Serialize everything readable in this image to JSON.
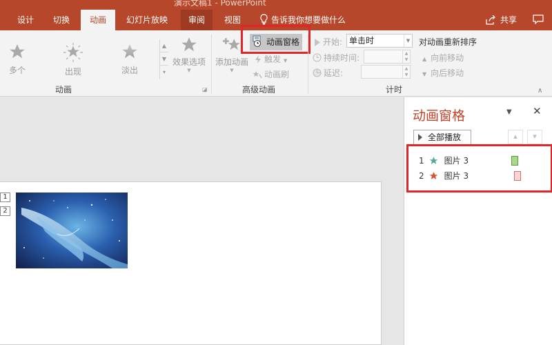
{
  "window": {
    "title": "演示文稿1 - PowerPoint"
  },
  "tabs": [
    "设计",
    "切换",
    "动画",
    "幻灯片放映",
    "审阅",
    "视图"
  ],
  "tell_me": "告诉我你想要做什么",
  "share_label": "共享",
  "ribbon": {
    "gallery": [
      "多个",
      "出现",
      "淡出"
    ],
    "effect_options": "效果选项",
    "add_animation": "添加动画",
    "animation_pane": "动画窗格",
    "trigger": "触发",
    "animation_painter": "动画刷",
    "start_label": "开始:",
    "start_value": "单击时",
    "duration_label": "持续时间:",
    "delay_label": "延迟:",
    "reorder_title": "对动画重新排序",
    "move_earlier": "向前移动",
    "move_later": "向后移动",
    "groups": {
      "animation": "动画",
      "advanced": "高级动画",
      "timing": "计时"
    }
  },
  "slide": {
    "tags": [
      "1",
      "2"
    ]
  },
  "animation_pane": {
    "title": "动画窗格",
    "play_all": "全部播放",
    "items": [
      {
        "num": "1",
        "name": "图片 3",
        "star_color": "#5aa79b",
        "bar_color": "#a6d98c",
        "bar_border": "#5f9a3e"
      },
      {
        "num": "2",
        "name": "图片 3",
        "star_color": "#d9532f",
        "bar_color": "#fbd3d3",
        "bar_border": "#d07070"
      }
    ]
  },
  "colors": {
    "accent": "#b7472a",
    "highlight": "#e0262a"
  }
}
